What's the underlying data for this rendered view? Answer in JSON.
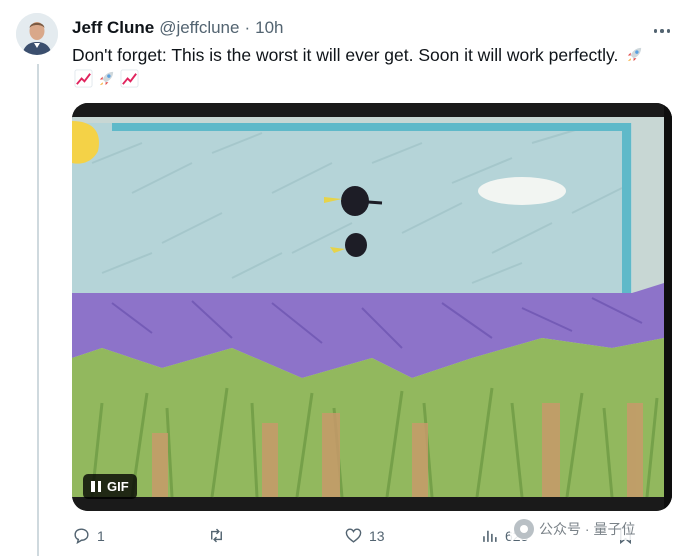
{
  "author": {
    "name": "Jeff Clune",
    "handle": "@jeffclune",
    "separator": "·",
    "time": "10h"
  },
  "tweet": {
    "text": "Don't forget: This is the worst it will ever get. Soon it will work perfectly."
  },
  "media": {
    "type_label": "GIF"
  },
  "actions": {
    "replies": "1",
    "retweets": "",
    "likes": "13",
    "views": "625"
  },
  "watermark": {
    "text": "公众号 · 量子位"
  },
  "colors": {
    "text": "#0f1419",
    "secondary": "#536471",
    "thread_line": "#cfd9de",
    "sky": "#b3d3d8",
    "mountains": "#8b6ec8",
    "grass": "#8fb85a"
  }
}
